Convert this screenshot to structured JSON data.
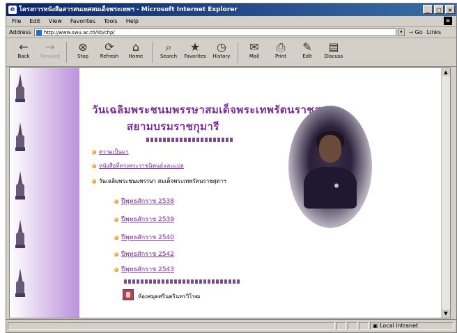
{
  "window": {
    "title": "โครงการหนังสือสารสนเทศสมเด็จพระเทพฯ - Microsoft Internet Explorer",
    "buttons": [
      "_",
      "□",
      "×"
    ]
  },
  "menu": [
    "File",
    "Edit",
    "View",
    "Favorites",
    "Tools",
    "Help"
  ],
  "address": {
    "label": "Address",
    "url": "http://www.swu.ac.th/lib/chp/",
    "go_label": "Go",
    "links_label": "Links"
  },
  "toolbar": [
    {
      "label": "Back",
      "icon": "back-arrow-icon",
      "glyph": "←",
      "enabled": true
    },
    {
      "label": "Forward",
      "icon": "forward-arrow-icon",
      "glyph": "→",
      "enabled": false
    },
    {
      "label": "Stop",
      "icon": "stop-icon",
      "glyph": "⊗",
      "enabled": true
    },
    {
      "label": "Refresh",
      "icon": "refresh-icon",
      "glyph": "⟳",
      "enabled": true
    },
    {
      "label": "Home",
      "icon": "home-icon",
      "glyph": "⌂",
      "enabled": true
    },
    {
      "label": "Search",
      "icon": "search-icon",
      "glyph": "⌕",
      "enabled": true
    },
    {
      "label": "Favorites",
      "icon": "favorites-icon",
      "glyph": "★",
      "enabled": true
    },
    {
      "label": "History",
      "icon": "history-icon",
      "glyph": "◷",
      "enabled": true
    },
    {
      "label": "Mail",
      "icon": "mail-icon",
      "glyph": "✉",
      "enabled": true
    },
    {
      "label": "Print",
      "icon": "print-icon",
      "glyph": "⎙",
      "enabled": true
    },
    {
      "label": "Edit",
      "icon": "edit-icon",
      "glyph": "✎",
      "enabled": true
    },
    {
      "label": "Discuss",
      "icon": "discuss-icon",
      "glyph": "▤",
      "enabled": true
    }
  ],
  "page": {
    "heading1": "วันเฉลิมพระชนมพรรษาสมเด็จพระเทพรัตนราชสุดาฯ",
    "heading2": "สยามบรมราชกุมารี",
    "links_top": [
      "ความเป็นมา",
      "หนังสือที่ทรงพระราชนิพนธ์และแปล"
    ],
    "section_label": "วันเฉลิมพระชนมพรรษา สมเด็จพระเทพรัตนราชสุดาฯ",
    "years": [
      "ปีพุทธศักราช 2538",
      "ปีพุทธศักราช 2539",
      "ปีพุทธศักราช 2540",
      "ปีพุทธศักราช 2542",
      "ปีพุทธศักราช 2543"
    ],
    "footer_link": "ห้องสมุดศรีนครินทรวิโรฒ"
  },
  "status": {
    "left": "",
    "zone": "Local intranet"
  },
  "colors": {
    "title_gradient_start": "#0a246a",
    "heading": "#7a2a9a",
    "sidebar": "#c9a6e3"
  }
}
